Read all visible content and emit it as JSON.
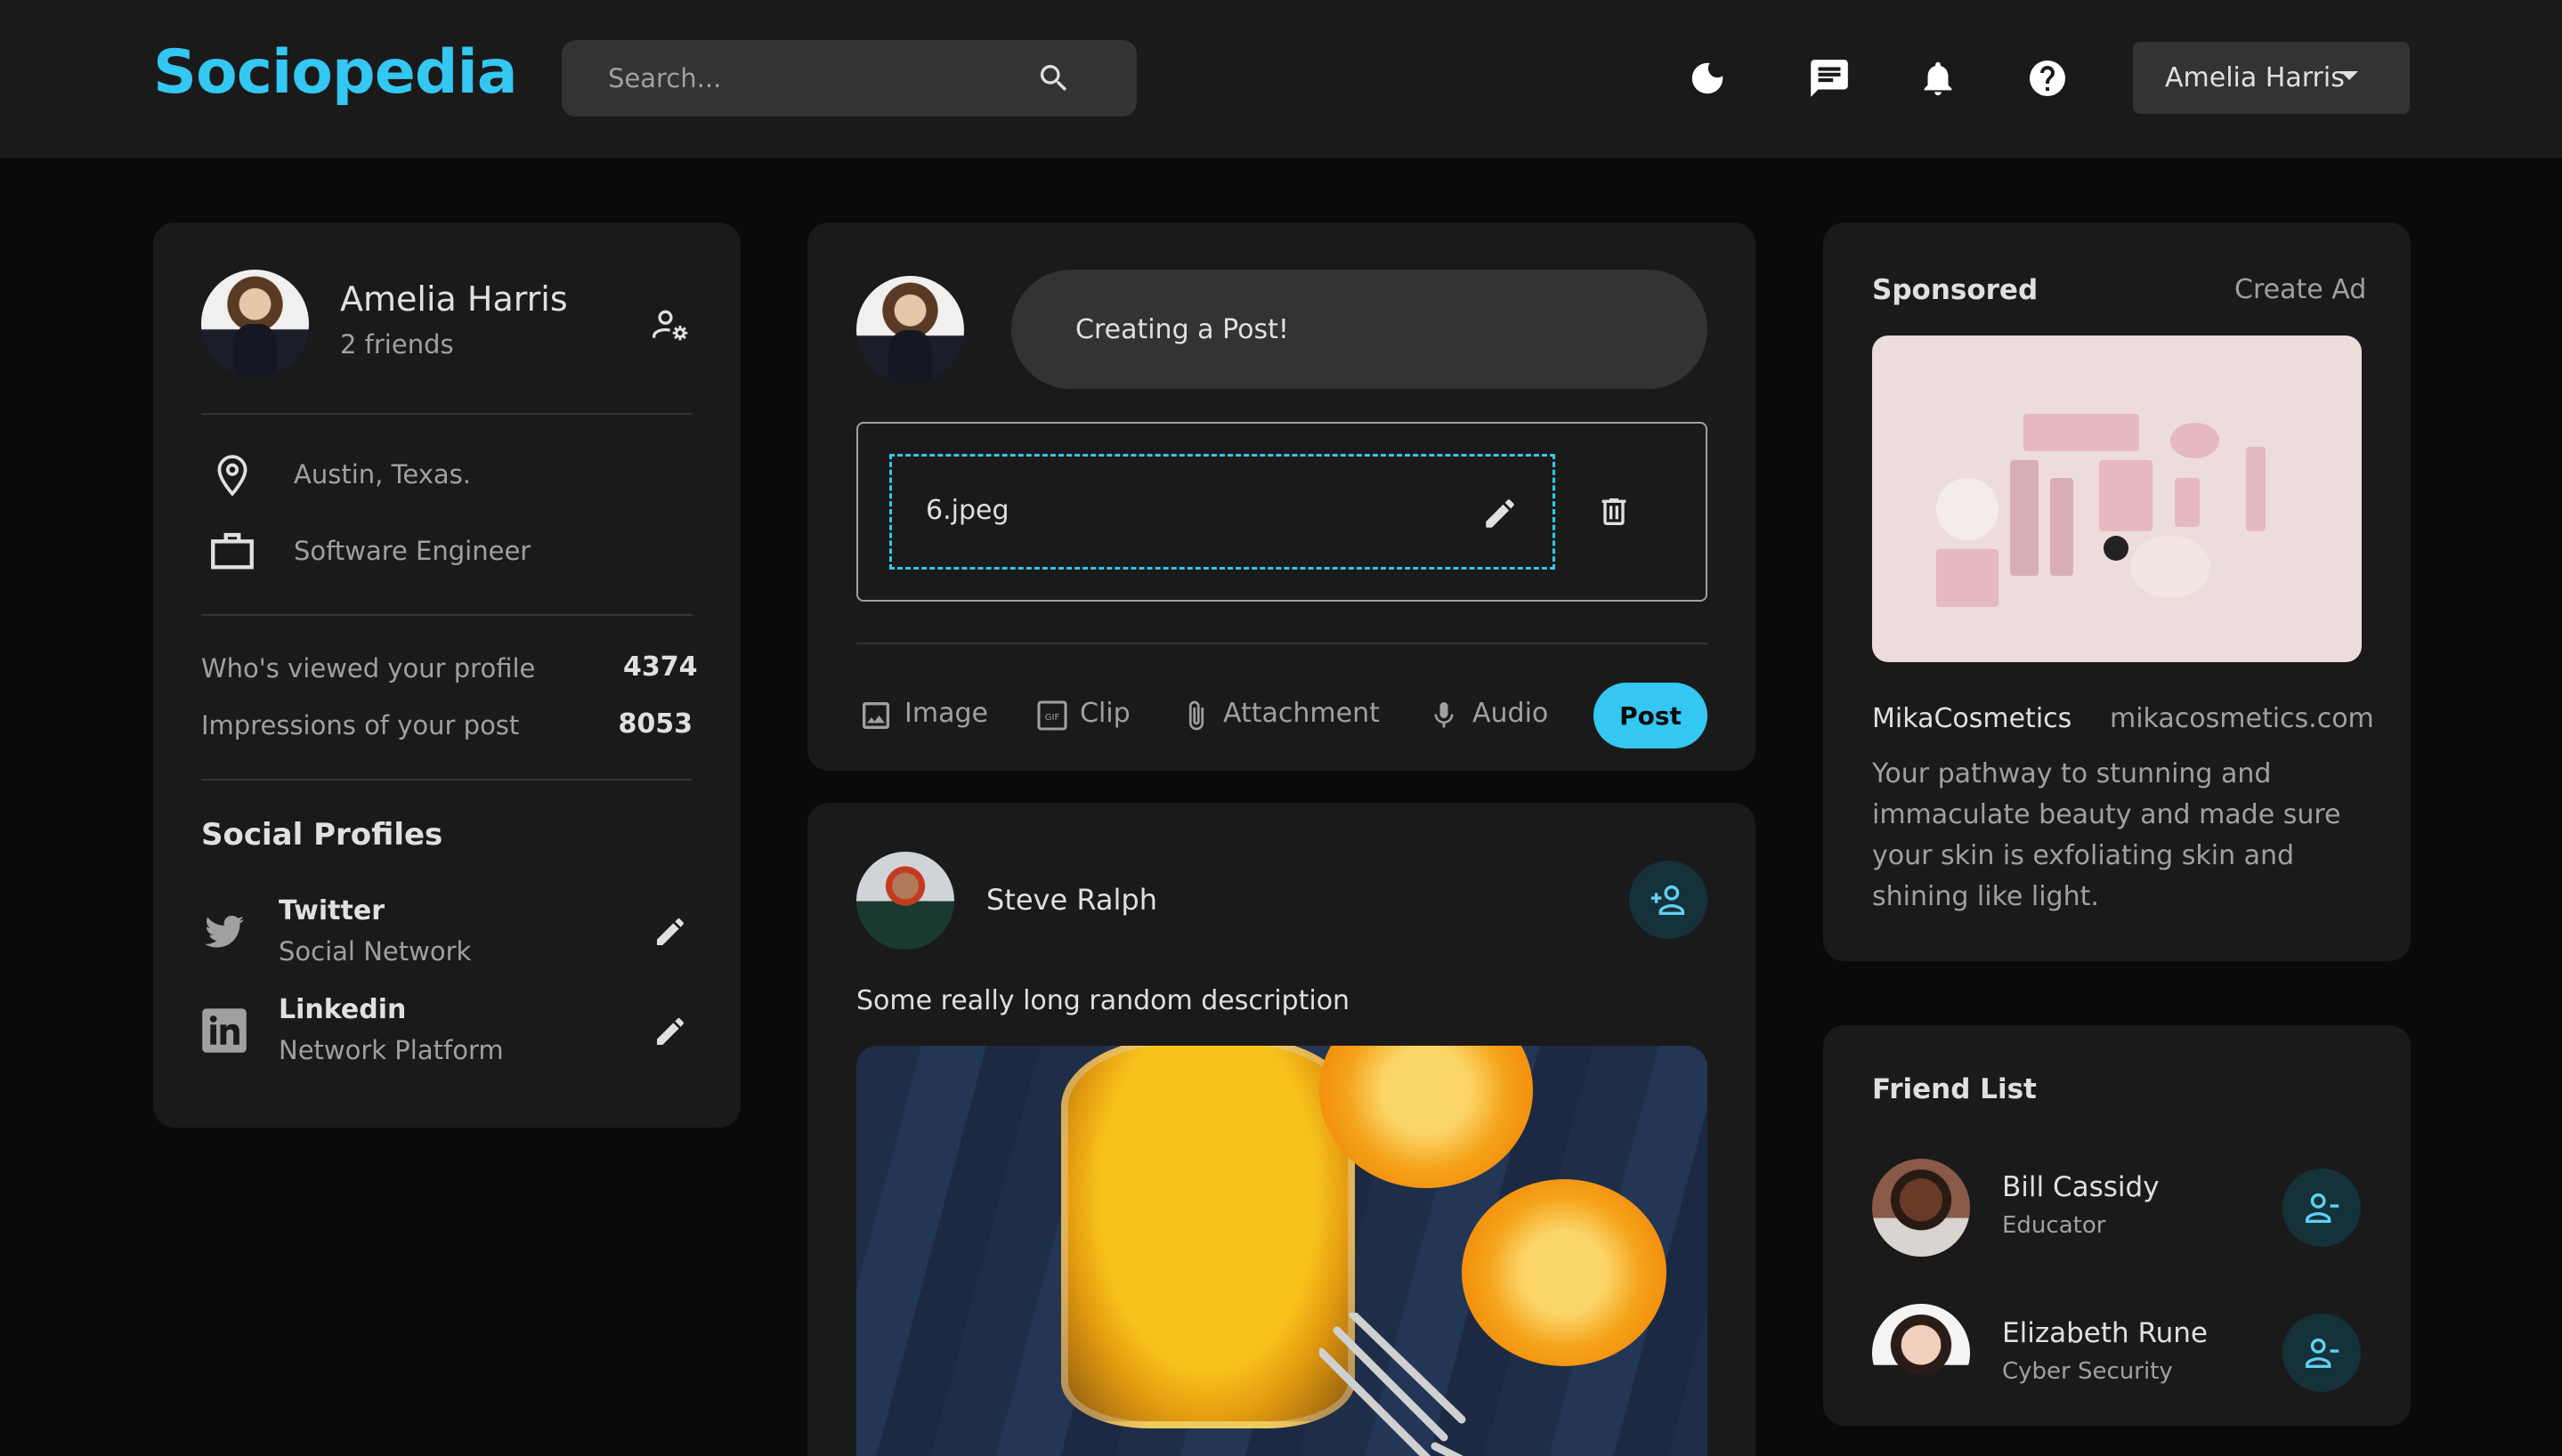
{
  "navbar": {
    "logo": "Sociopedia",
    "search_placeholder": "Search...",
    "user_name": "Amelia Harris",
    "icons": [
      "moon-icon",
      "message-icon",
      "bell-icon",
      "help-icon"
    ]
  },
  "profile": {
    "name": "Amelia Harris",
    "friends": "2 friends",
    "location": "Austin, Texas.",
    "occupation": "Software Engineer",
    "viewed_label": "Who's viewed your profile",
    "viewed_value": "4374",
    "impressions_label": "Impressions of your post",
    "impressions_value": "8053",
    "social_title": "Social Profiles",
    "socials": [
      {
        "name": "Twitter",
        "type": "Social Network"
      },
      {
        "name": "Linkedin",
        "type": "Network Platform"
      }
    ]
  },
  "composer": {
    "placeholder": "Creating a Post!",
    "file_name": "6.jpeg",
    "actions": [
      "Image",
      "Clip",
      "Attachment",
      "Audio"
    ],
    "post_label": "Post"
  },
  "post": {
    "author": "Steve Ralph",
    "description": "Some really long random description"
  },
  "sponsored": {
    "title": "Sponsored",
    "create_ad": "Create Ad",
    "brand": "MikaCosmetics",
    "url": "mikacosmetics.com",
    "description_lines": [
      "Your pathway to stunning and",
      "immaculate beauty and made sure",
      "your skin is exfoliating skin and",
      "shining like light."
    ]
  },
  "friend_list": {
    "title": "Friend List",
    "friends": [
      {
        "name": "Bill Cassidy",
        "role": "Educator"
      },
      {
        "name": "Elizabeth Rune",
        "role": "Cyber Security"
      }
    ]
  },
  "colors": {
    "accent": "#33c7f2",
    "background": "#0a0a0a",
    "panel": "#1a1a1a",
    "input": "#333333"
  }
}
